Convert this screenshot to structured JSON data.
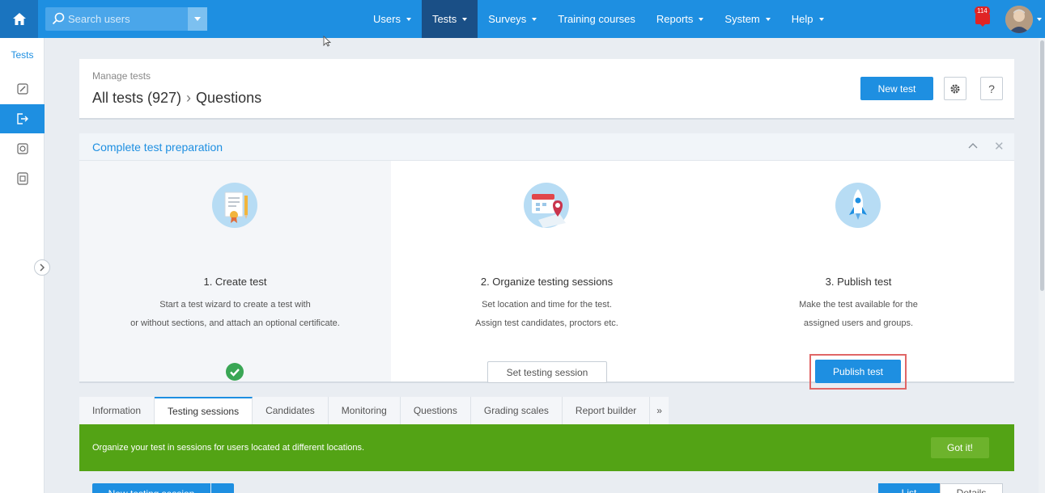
{
  "topbar": {
    "search_placeholder": "Search users",
    "nav": [
      {
        "label": "Users",
        "has_caret": true,
        "active": false
      },
      {
        "label": "Tests",
        "has_caret": true,
        "active": true
      },
      {
        "label": "Surveys",
        "has_caret": true,
        "active": false
      },
      {
        "label": "Training courses",
        "has_caret": false,
        "active": false
      },
      {
        "label": "Reports",
        "has_caret": true,
        "active": false
      },
      {
        "label": "System",
        "has_caret": true,
        "active": false
      },
      {
        "label": "Help",
        "has_caret": true,
        "active": false
      }
    ],
    "notification_count": "114"
  },
  "sidebar": {
    "title": "Tests",
    "icons": [
      "edit-icon",
      "export-icon",
      "badge-icon",
      "archive-icon"
    ]
  },
  "header": {
    "subtitle": "Manage tests",
    "title_root": "All tests (927)",
    "title_separator": "›",
    "title_current": "Questions",
    "new_test_label": "New test",
    "help_label": "?"
  },
  "prep": {
    "title": "Complete test preparation",
    "steps": [
      {
        "title": "1. Create test",
        "desc_line1": "Start a test wizard to create a test with",
        "desc_line2": "or without sections, and attach an optional certificate.",
        "status": "completed"
      },
      {
        "title": "2. Organize testing sessions",
        "desc_line1": "Set location and time for the test.",
        "desc_line2": "Assign test candidates, proctors etc.",
        "action_label": "Set testing session"
      },
      {
        "title": "3. Publish test",
        "desc_line1": "Make the test available for the",
        "desc_line2": "assigned users and groups.",
        "action_label": "Publish test"
      }
    ]
  },
  "tabs": [
    {
      "label": "Information",
      "active": false
    },
    {
      "label": "Testing sessions",
      "active": true
    },
    {
      "label": "Candidates",
      "active": false
    },
    {
      "label": "Monitoring",
      "active": false
    },
    {
      "label": "Questions",
      "active": false
    },
    {
      "label": "Grading scales",
      "active": false
    },
    {
      "label": "Report builder",
      "active": false
    }
  ],
  "tabs_more": "»",
  "banner": {
    "text": "Organize your test in sessions for users located at different locations.",
    "button_label": "Got it!"
  },
  "bottom": {
    "new_session_label": "New testing session",
    "view_list_label": "List",
    "view_details_label": "Details"
  },
  "colors": {
    "primary": "#1e8fe1",
    "nav_active": "#1a4f86",
    "banner_green": "#53a315",
    "highlight_red": "#e06666",
    "check_green": "#3aa655"
  }
}
